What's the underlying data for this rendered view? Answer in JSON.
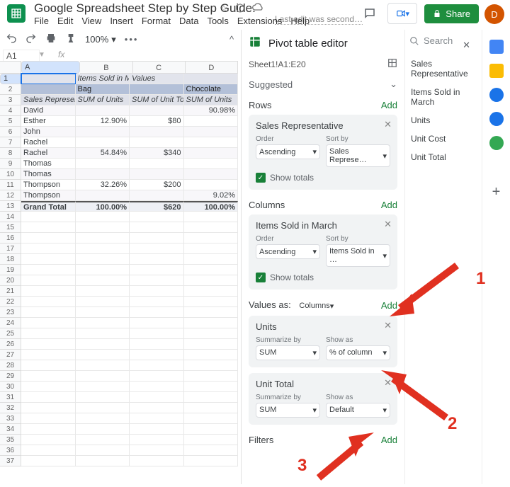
{
  "doc": {
    "title": "Google Spreadsheet Step by Step Guide.",
    "last_edit": "Last edit was second…",
    "share_label": "Share",
    "avatar_letter": "D"
  },
  "menu": [
    "File",
    "Edit",
    "View",
    "Insert",
    "Format",
    "Data",
    "Tools",
    "Extensions",
    "Help"
  ],
  "toolbar": {
    "zoom": "100%"
  },
  "namebox": "A1",
  "sheet": {
    "cols": [
      "A",
      "B",
      "C",
      "D"
    ],
    "rows": [
      {
        "n": "1",
        "cls": "r-head",
        "cells": [
          "",
          "Items Sold in Ma",
          "Values",
          ""
        ]
      },
      {
        "n": "2",
        "cls": "r-blue",
        "cells": [
          "",
          "Bag",
          "",
          "Chocolate"
        ]
      },
      {
        "n": "3",
        "cls": "r-head2",
        "cells": [
          "Sales Representa",
          "SUM of Units",
          "SUM of Unit Tot",
          "SUM of Units"
        ],
        "it": true
      },
      {
        "n": "4",
        "cls": "r-light",
        "cells": [
          "David",
          "",
          "",
          "90.98%"
        ],
        "right": [
          false,
          true,
          true,
          true
        ]
      },
      {
        "n": "5",
        "cls": "",
        "cells": [
          "Esther",
          "12.90%",
          "$80",
          ""
        ],
        "right": [
          false,
          true,
          true,
          true
        ]
      },
      {
        "n": "6",
        "cls": "r-light",
        "cells": [
          "John",
          "",
          "",
          ""
        ],
        "right": [
          false,
          true,
          true,
          true
        ]
      },
      {
        "n": "7",
        "cls": "",
        "cells": [
          "Rachel",
          "",
          "",
          ""
        ],
        "right": [
          false,
          true,
          true,
          true
        ]
      },
      {
        "n": "8",
        "cls": "r-light",
        "cells": [
          "Rachel",
          "54.84%",
          "$340",
          ""
        ],
        "right": [
          false,
          true,
          true,
          true
        ]
      },
      {
        "n": "9",
        "cls": "",
        "cells": [
          "Thomas",
          "",
          "",
          ""
        ],
        "right": [
          false,
          true,
          true,
          true
        ]
      },
      {
        "n": "10",
        "cls": "r-light",
        "cells": [
          "Thomas",
          "",
          "",
          ""
        ],
        "right": [
          false,
          true,
          true,
          true
        ]
      },
      {
        "n": "11",
        "cls": "",
        "cells": [
          "Thompson",
          "32.26%",
          "$200",
          ""
        ],
        "right": [
          false,
          true,
          true,
          true
        ]
      },
      {
        "n": "12",
        "cls": "r-light",
        "cells": [
          "Thompson",
          "",
          "",
          "9.02%"
        ],
        "right": [
          false,
          true,
          true,
          true
        ]
      },
      {
        "n": "13",
        "cls": "r-total",
        "cells": [
          "Grand Total",
          "100.00%",
          "$620",
          "100.00%"
        ],
        "right": [
          false,
          true,
          true,
          true
        ]
      }
    ],
    "empty_rows": [
      "14",
      "15",
      "16",
      "17",
      "18",
      "19",
      "20",
      "21",
      "22",
      "23",
      "24",
      "25",
      "26",
      "27",
      "28",
      "29",
      "30",
      "31",
      "32",
      "33",
      "34",
      "35",
      "36",
      "37"
    ]
  },
  "editor": {
    "title": "Pivot table editor",
    "range": "Sheet1!A1:E20",
    "suggested_label": "Suggested",
    "rows_label": "Rows",
    "columns_label": "Columns",
    "values_label_prefix": "Values as:",
    "values_mode": "Columns",
    "filters_label": "Filters",
    "add_label": "Add",
    "order_label": "Order",
    "sortby_label": "Sort by",
    "showtotals_label": "Show totals",
    "summarize_label": "Summarize by",
    "showas_label": "Show as",
    "rows_box": {
      "title": "Sales Representative",
      "order": "Ascending",
      "sortby": "Sales Represe…"
    },
    "cols_box": {
      "title": "Items Sold in March",
      "order": "Ascending",
      "sortby": "Items Sold in …"
    },
    "vals": [
      {
        "title": "Units",
        "summarize": "SUM",
        "showas": "% of column"
      },
      {
        "title": "Unit Total",
        "summarize": "SUM",
        "showas": "Default"
      }
    ],
    "side_search_placeholder": "Search",
    "side_fields": [
      "Sales Representative",
      "Items Sold in March",
      "Units",
      "Unit Cost",
      "Unit Total"
    ]
  },
  "annotations": {
    "a1": "1",
    "a2": "2",
    "a3": "3"
  }
}
